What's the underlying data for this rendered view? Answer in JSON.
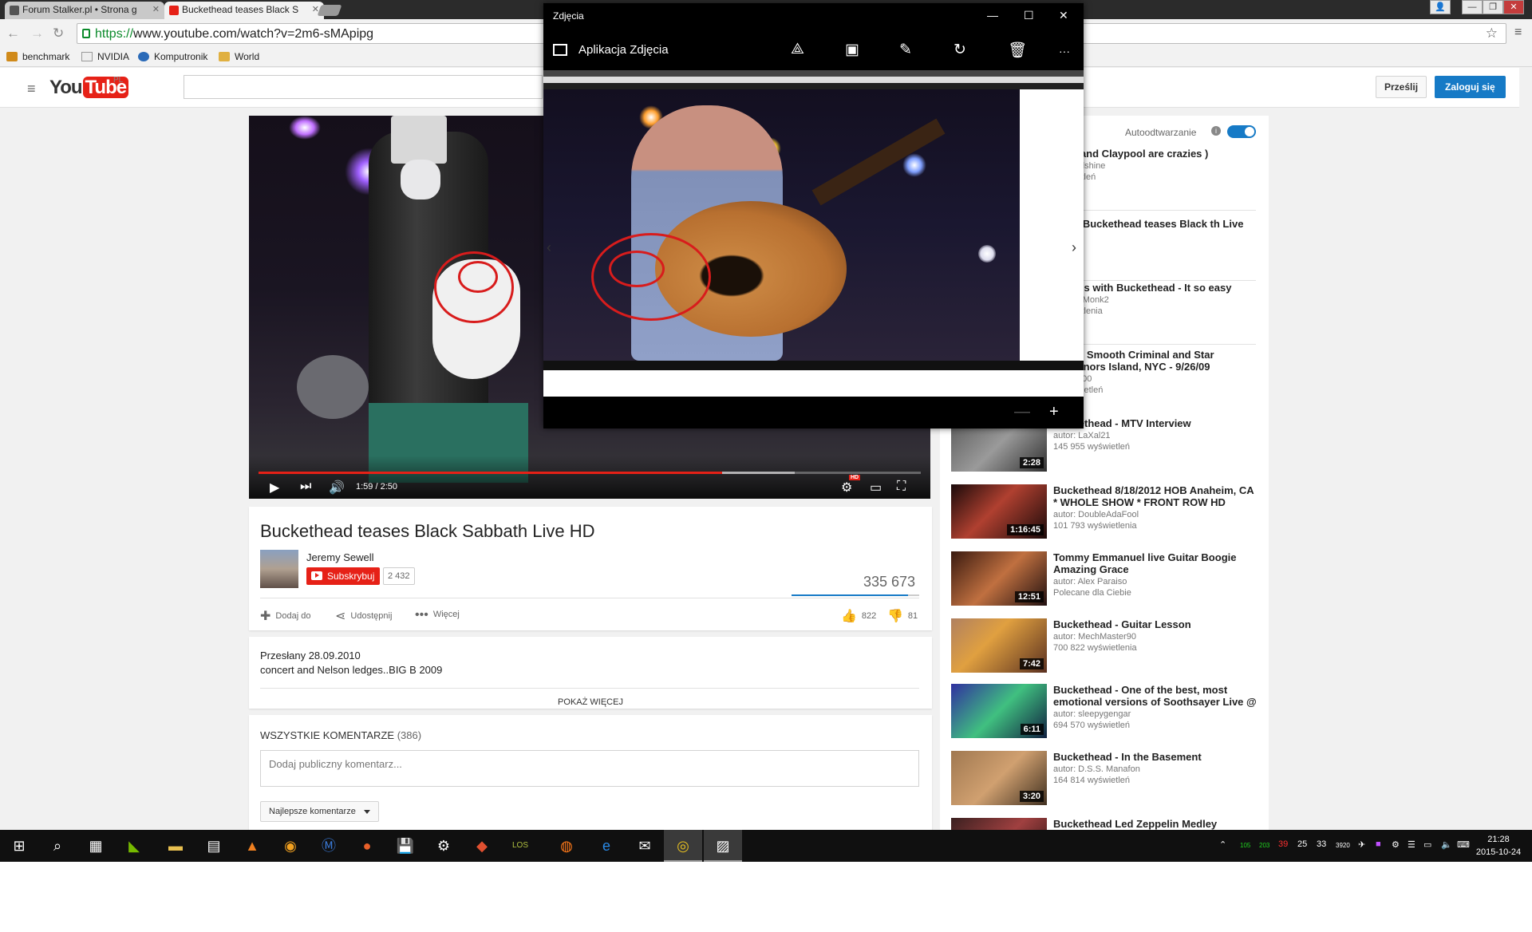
{
  "browser": {
    "tabs": [
      {
        "label": "Forum Stalker.pl • Strona g",
        "active": false
      },
      {
        "label": "Buckethead teases Black S",
        "active": true
      }
    ],
    "url_scheme": "https://",
    "url_rest": "www.youtube.com/watch?v=2m6-sMApipg",
    "bookmarks": [
      "benchmark",
      "NVIDIA",
      "Komputronik",
      "World"
    ]
  },
  "youtube": {
    "region": "PL",
    "upload_label": "Prześlij",
    "login_label": "Zaloguj się"
  },
  "player": {
    "time": "1:59 / 2:50",
    "progress_fraction": 0.7,
    "buffered_fraction": 0.81,
    "hd_badge": "HD"
  },
  "video": {
    "title": "Buckethead teases Black Sabbath Live HD",
    "channel": "Jeremy Sewell",
    "subscribe_label": "Subskrybuj",
    "subscribers": "2 432",
    "views": "335 673",
    "like_ratio": 0.91,
    "actions": {
      "add": "Dodaj do",
      "share": "Udostępnij",
      "more": "Więcej"
    },
    "likes": "822",
    "dislikes": "81",
    "uploaded": "Przesłany 28.09.2010",
    "description": "concert and Nelson ledges..BIG B 2009",
    "show_more": "POKAŻ WIĘCEJ"
  },
  "comments": {
    "header": "WSZYSTKIE KOMENTARZE",
    "count": "(386)",
    "placeholder": "Dodaj publiczny komentarz...",
    "sort_label": "Najlepsze komentarze"
  },
  "sidebar": {
    "autoplay_label": "Autoodtwarzanie",
    "related": [
      {
        "title": "head and Claypool are crazies )",
        "author": "osunwillshine",
        "meta": "wyświetleń",
        "duration": ""
      },
      {
        "title": "nka – Buckethead teases Black th Live HD",
        "author": "ouTube",
        "meta": "",
        "duration": ""
      },
      {
        "title": "' Roses with Buckethead - It so easy",
        "author": "hantomMonk2",
        "meta": "wyświetlenia",
        "duration": ""
      },
      {
        "title": "head - Smooth Criminal and Star Governors Island, NYC - 9/26/09",
        "author": "Hero5000",
        "meta": "7 wyświetleń",
        "duration": ""
      },
      {
        "title": "Buckethead - MTV Interview",
        "author": "autor: LaXal21",
        "meta": "145 955 wyświetleń",
        "duration": "2:28"
      },
      {
        "title": "Buckethead 8/18/2012 HOB Anaheim, CA * WHOLE SHOW * FRONT ROW HD",
        "author": "autor: DoubleAdaFool",
        "meta": "101 793 wyświetlenia",
        "duration": "1:16:45"
      },
      {
        "title": "Tommy Emmanuel live Guitar Boogie Amazing Grace",
        "author": "autor: Alex Paraiso",
        "meta": "Polecane dla Ciebie",
        "duration": "12:51"
      },
      {
        "title": "Buckethead - Guitar Lesson",
        "author": "autor: MechMaster90",
        "meta": "700 822 wyświetlenia",
        "duration": "7:42"
      },
      {
        "title": "Buckethead - One of the best, most emotional versions of Soothsayer Live @",
        "author": "autor: sleepygengar",
        "meta": "694 570 wyświetleń",
        "duration": "6:11"
      },
      {
        "title": "Buckethead - In the Basement",
        "author": "autor: D.S.S. Manafon",
        "meta": "164 814 wyświetleń",
        "duration": "3:20"
      },
      {
        "title": "Buckethead Led Zeppelin Medley",
        "author": "",
        "meta": "",
        "duration": ""
      }
    ]
  },
  "photos_app": {
    "window_title": "Zdjęcia",
    "app_title": "Aplikacja Zdjęcia"
  },
  "taskbar": {
    "tray_numbers": [
      "105",
      "203",
      "39",
      "25",
      "33",
      "3920"
    ],
    "time": "21:28",
    "date": "2015-10-24"
  }
}
